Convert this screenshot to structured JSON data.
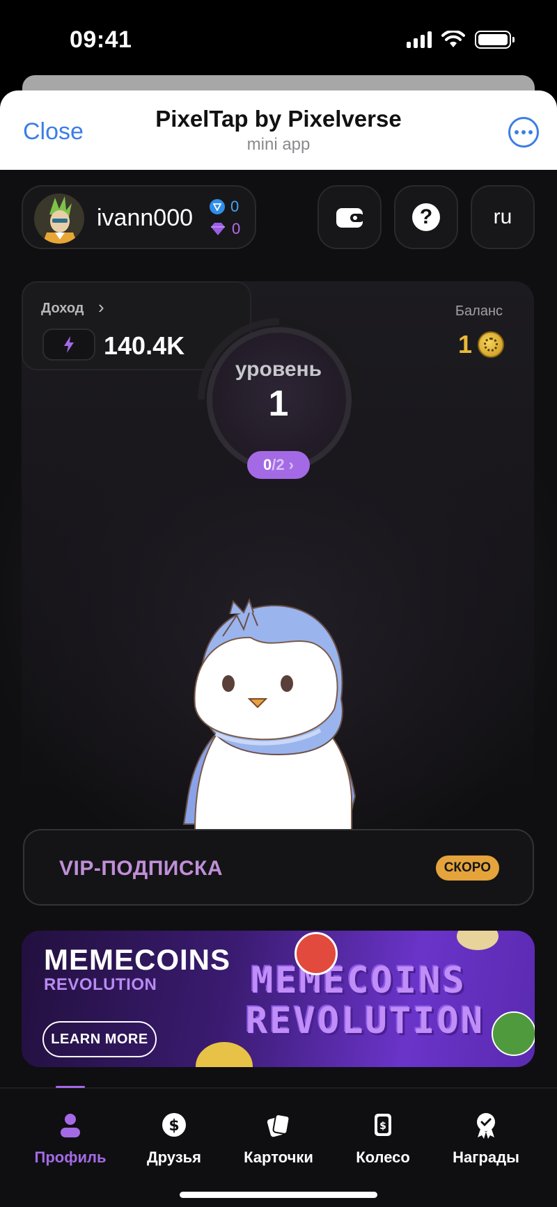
{
  "status_bar": {
    "time": "09:41"
  },
  "header": {
    "close_label": "Close",
    "title": "PixelTap by Pixelverse",
    "subtitle": "mini app"
  },
  "profile": {
    "username": "ivann000",
    "ton_count": "0",
    "gem_count": "0"
  },
  "actions": {
    "language": "ru"
  },
  "income": {
    "label": "Доход",
    "value": "140.4K"
  },
  "balance": {
    "label": "Баланс",
    "value": "1"
  },
  "level": {
    "label": "уровень",
    "number": "1",
    "progress_current": "0",
    "progress_total": "/2"
  },
  "vip": {
    "title": "VIP-ПОДПИСКА",
    "badge": "СКОРО"
  },
  "banner": {
    "title": "MEMECOINS",
    "subtitle": "REVOLUTION",
    "button": "LEARN MORE",
    "art_line1": "MEMECOINS",
    "art_line2": "REVOLUTION"
  },
  "tabs": [
    {
      "label": "Профиль",
      "icon": "profile-icon",
      "active": true
    },
    {
      "label": "Друзья",
      "icon": "dollar-icon"
    },
    {
      "label": "Карточки",
      "icon": "cards-icon"
    },
    {
      "label": "Колесо",
      "icon": "wheel-icon"
    },
    {
      "label": "Награды",
      "icon": "medal-icon"
    }
  ],
  "colors": {
    "accent": "#a46ae6",
    "link": "#3b7ee6",
    "gold": "#e9b939",
    "badge": "#e5a33b"
  }
}
